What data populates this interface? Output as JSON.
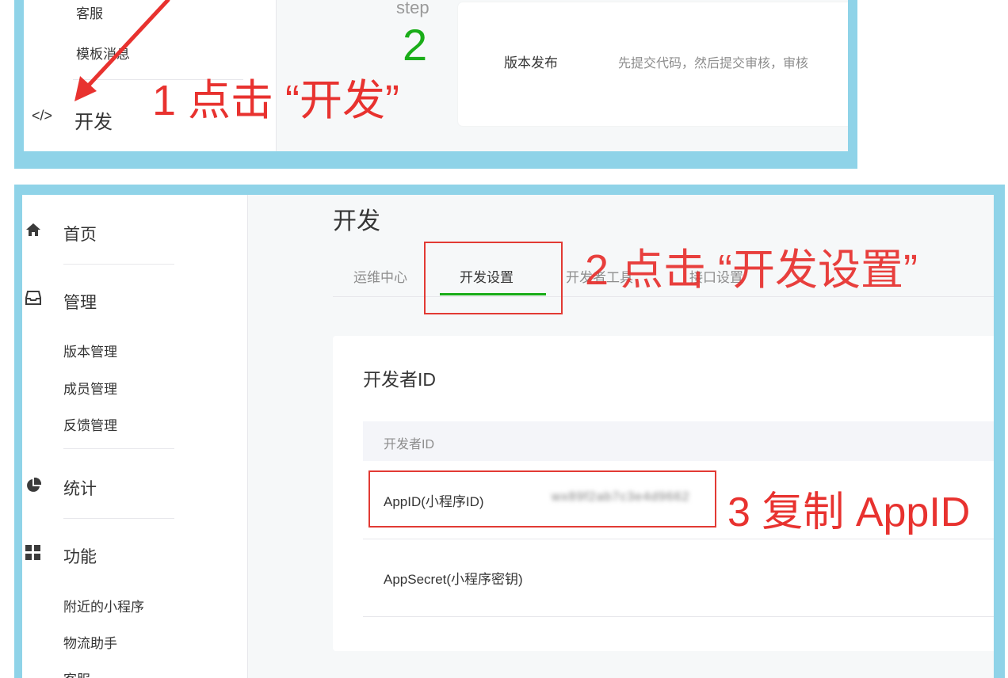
{
  "top_panel": {
    "menu": {
      "kefu": "客服",
      "template_msg": "模板消息",
      "dev": "开发"
    },
    "step": {
      "label": "step",
      "number": "2"
    },
    "release_card": {
      "title": "版本发布",
      "desc": "先提交代码，然后提交审核，审核"
    },
    "annotation": "1 点击 “开发”"
  },
  "bottom_panel": {
    "sidebar": {
      "home": "首页",
      "manage": "管理",
      "manage_items": [
        "版本管理",
        "成员管理",
        "反馈管理"
      ],
      "stats": "统计",
      "features": "功能",
      "feature_items": [
        "附近的小程序",
        "物流助手",
        "客服"
      ]
    },
    "page_title": "开发",
    "tabs": [
      "运维中心",
      "开发设置",
      "开发者工具",
      "接口设置"
    ],
    "active_tab": "开发设置",
    "section": {
      "title": "开发者ID",
      "table_header": "开发者ID",
      "rows": [
        {
          "label": "AppID(小程序ID)",
          "value": "wx89f2ab7c3e4d9662"
        },
        {
          "label": "AppSecret(小程序密钥)",
          "value": ""
        }
      ]
    },
    "annotations": {
      "step2": "2 点击 “开发设置”",
      "step3": "3 复制 AppID"
    }
  },
  "colors": {
    "panel_border": "#8fd3e8",
    "accent_green": "#1aad19",
    "annotation_red": "#e8322f"
  },
  "icons": [
    "code-icon",
    "home-icon",
    "inbox-icon",
    "pie-chart-icon",
    "grid-icon"
  ]
}
